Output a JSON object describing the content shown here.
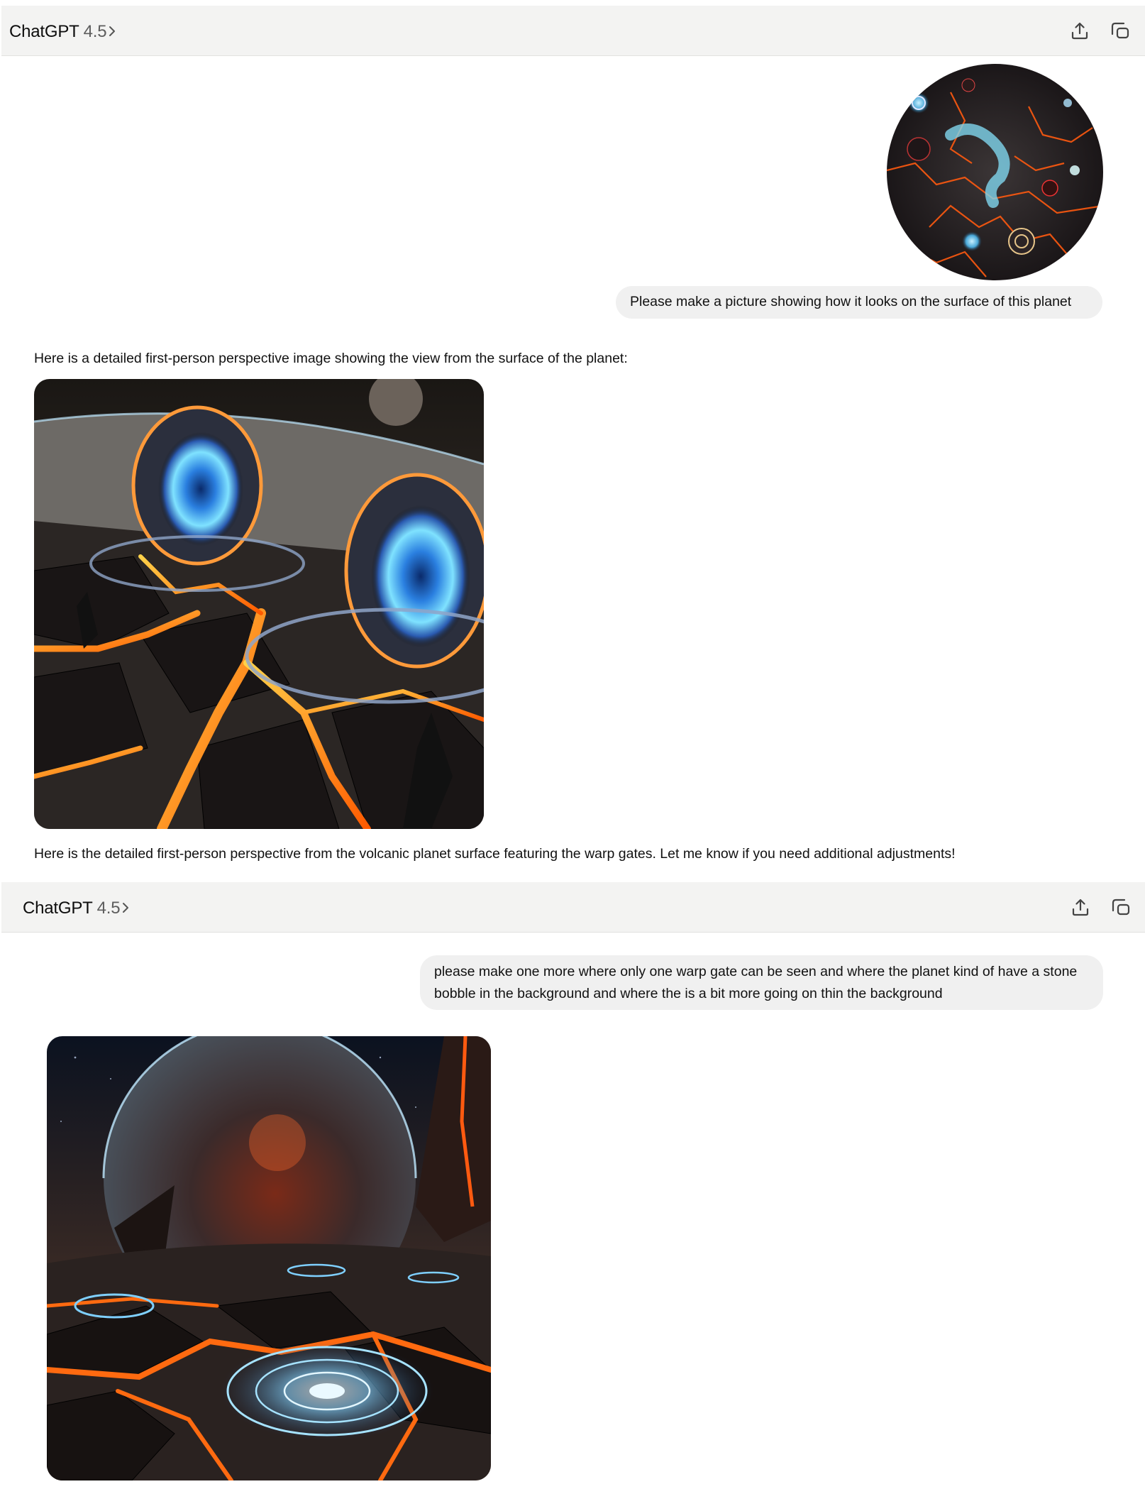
{
  "header": {
    "app_name": "ChatGPT",
    "model": "4.5",
    "chevron_icon": "chevron-right-icon",
    "share_icon": "share-upload-icon",
    "new_chat_icon": "new-window-icon"
  },
  "conversation": {
    "user_message_1": "Please make a picture showing how it looks on the surface of this planet",
    "assistant_intro_1": "Here is a detailed first-person perspective image showing the view from the surface of the planet:",
    "assistant_outro_1": "Here is the detailed first-person perspective from the volcanic planet surface featuring the warp gates. Let me know if you need additional adjustments!",
    "user_message_2": "please make one more where only one warp gate can be seen and where the planet kind of have a stone bobble in the background and where the is a bit more going on thin the background"
  },
  "colors": {
    "header_bg": "#f3f3f2",
    "bubble_bg": "#f0f0f0",
    "lava": "#ff7a1a",
    "warp_blue": "#39b4ff"
  }
}
